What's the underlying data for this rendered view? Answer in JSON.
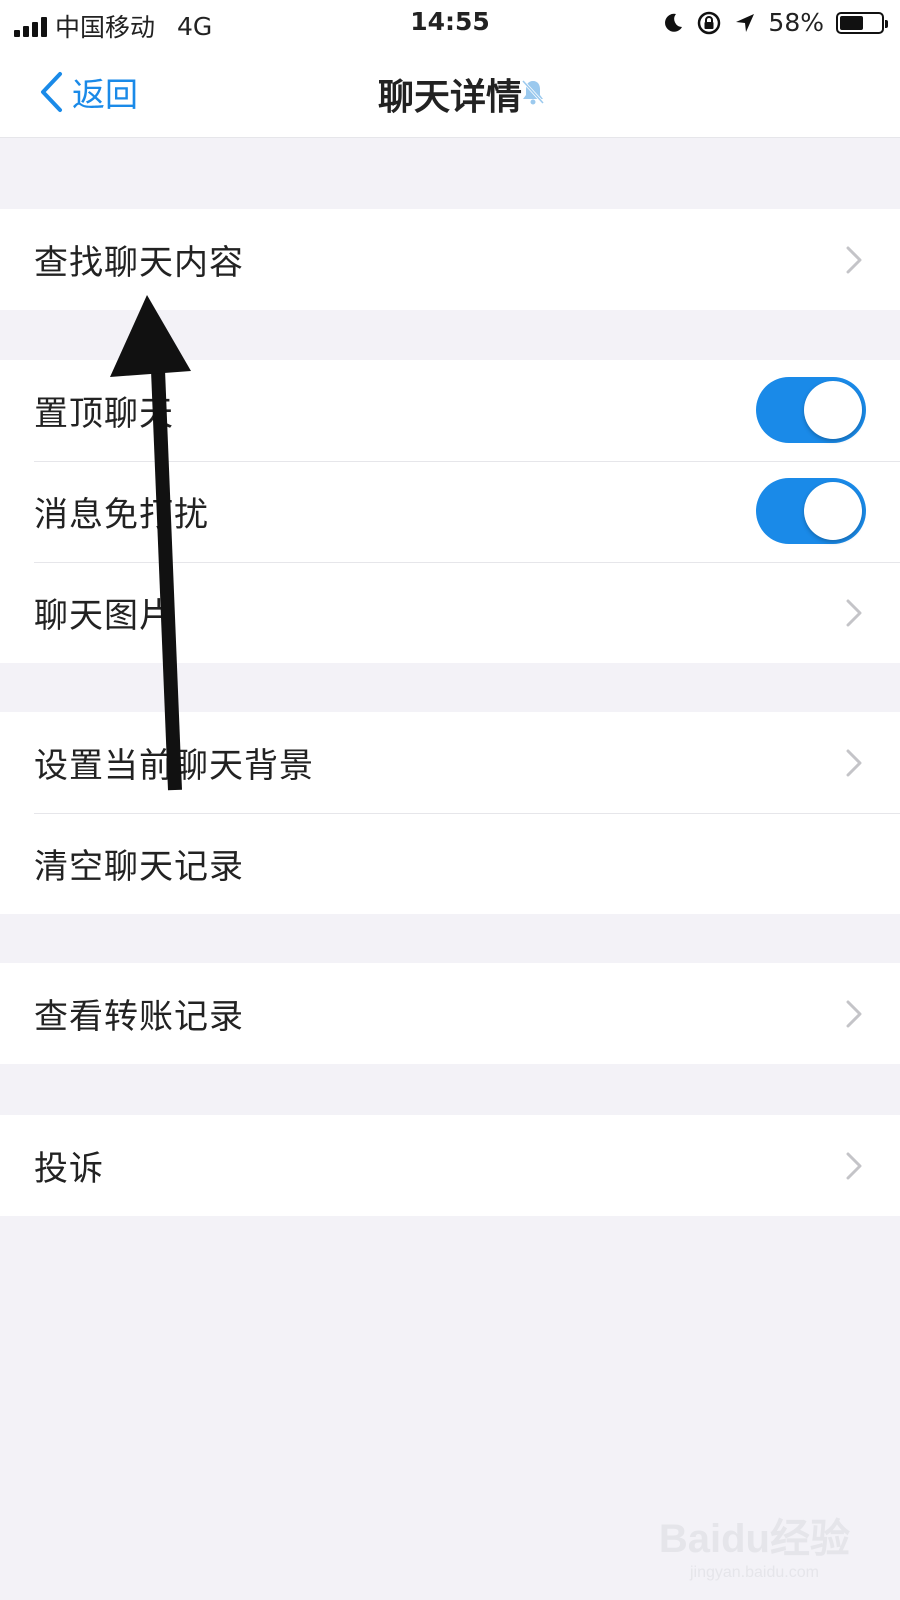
{
  "status_bar": {
    "carrier": "中国移动",
    "network": "4G",
    "time": "14:55",
    "battery": "58%",
    "battery_level": 0.58,
    "icons": [
      "signal-icon",
      "moon-icon",
      "rotation-lock-icon",
      "location-icon",
      "battery-icon"
    ]
  },
  "nav": {
    "back_label": "返回",
    "title": "聊天详情",
    "title_icon": "mute-bell-icon"
  },
  "sections": [
    {
      "rows": [
        {
          "label": "查找聊天内容",
          "control": "chevron"
        }
      ]
    },
    {
      "rows": [
        {
          "label": "置顶聊天",
          "control": "toggle",
          "on": true
        },
        {
          "label": "消息免打扰",
          "control": "toggle",
          "on": true
        },
        {
          "label": "聊天图片",
          "control": "chevron"
        }
      ]
    },
    {
      "rows": [
        {
          "label": "设置当前聊天背景",
          "control": "chevron"
        },
        {
          "label": "清空聊天记录",
          "control": "none"
        }
      ]
    },
    {
      "rows": [
        {
          "label": "查看转账记录",
          "control": "chevron"
        }
      ]
    },
    {
      "rows": [
        {
          "label": "投诉",
          "control": "chevron"
        }
      ]
    }
  ],
  "watermark": {
    "brand": "Baidu经验",
    "site": "jingyan.baidu.com"
  },
  "colors": {
    "accent": "#1a8ae8",
    "background": "#f3f2f7",
    "annotation_arrow": "#111111"
  }
}
